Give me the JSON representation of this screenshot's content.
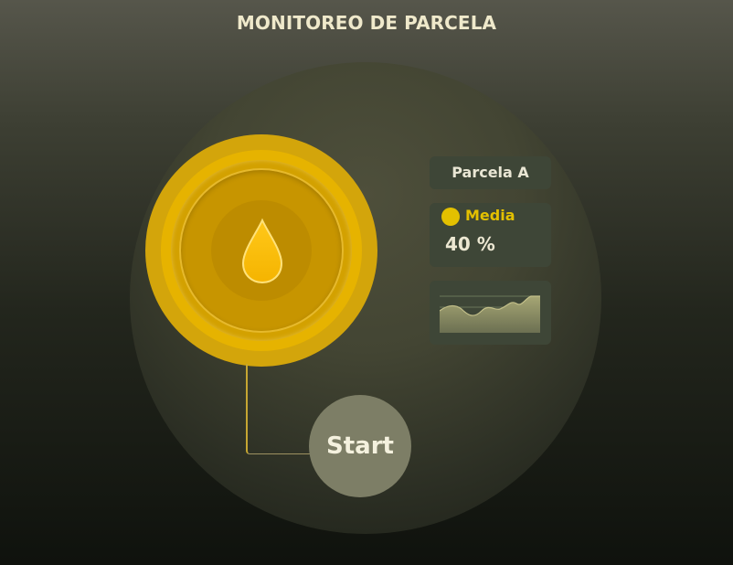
{
  "page": {
    "title": "MONITOREO DE PARCELA"
  },
  "knob": {
    "icon": "water-drop-icon"
  },
  "start_button": {
    "label": "Start"
  },
  "parcel": {
    "name": "Parcela A",
    "level_label": "Media",
    "level_value": "40 %",
    "level_color": "#e3c000"
  },
  "sparkline": {
    "icon": "sparkline-chart"
  },
  "colors": {
    "accent": "#e3c000",
    "knob": "#d3a50b",
    "title": "#efe9cb"
  }
}
